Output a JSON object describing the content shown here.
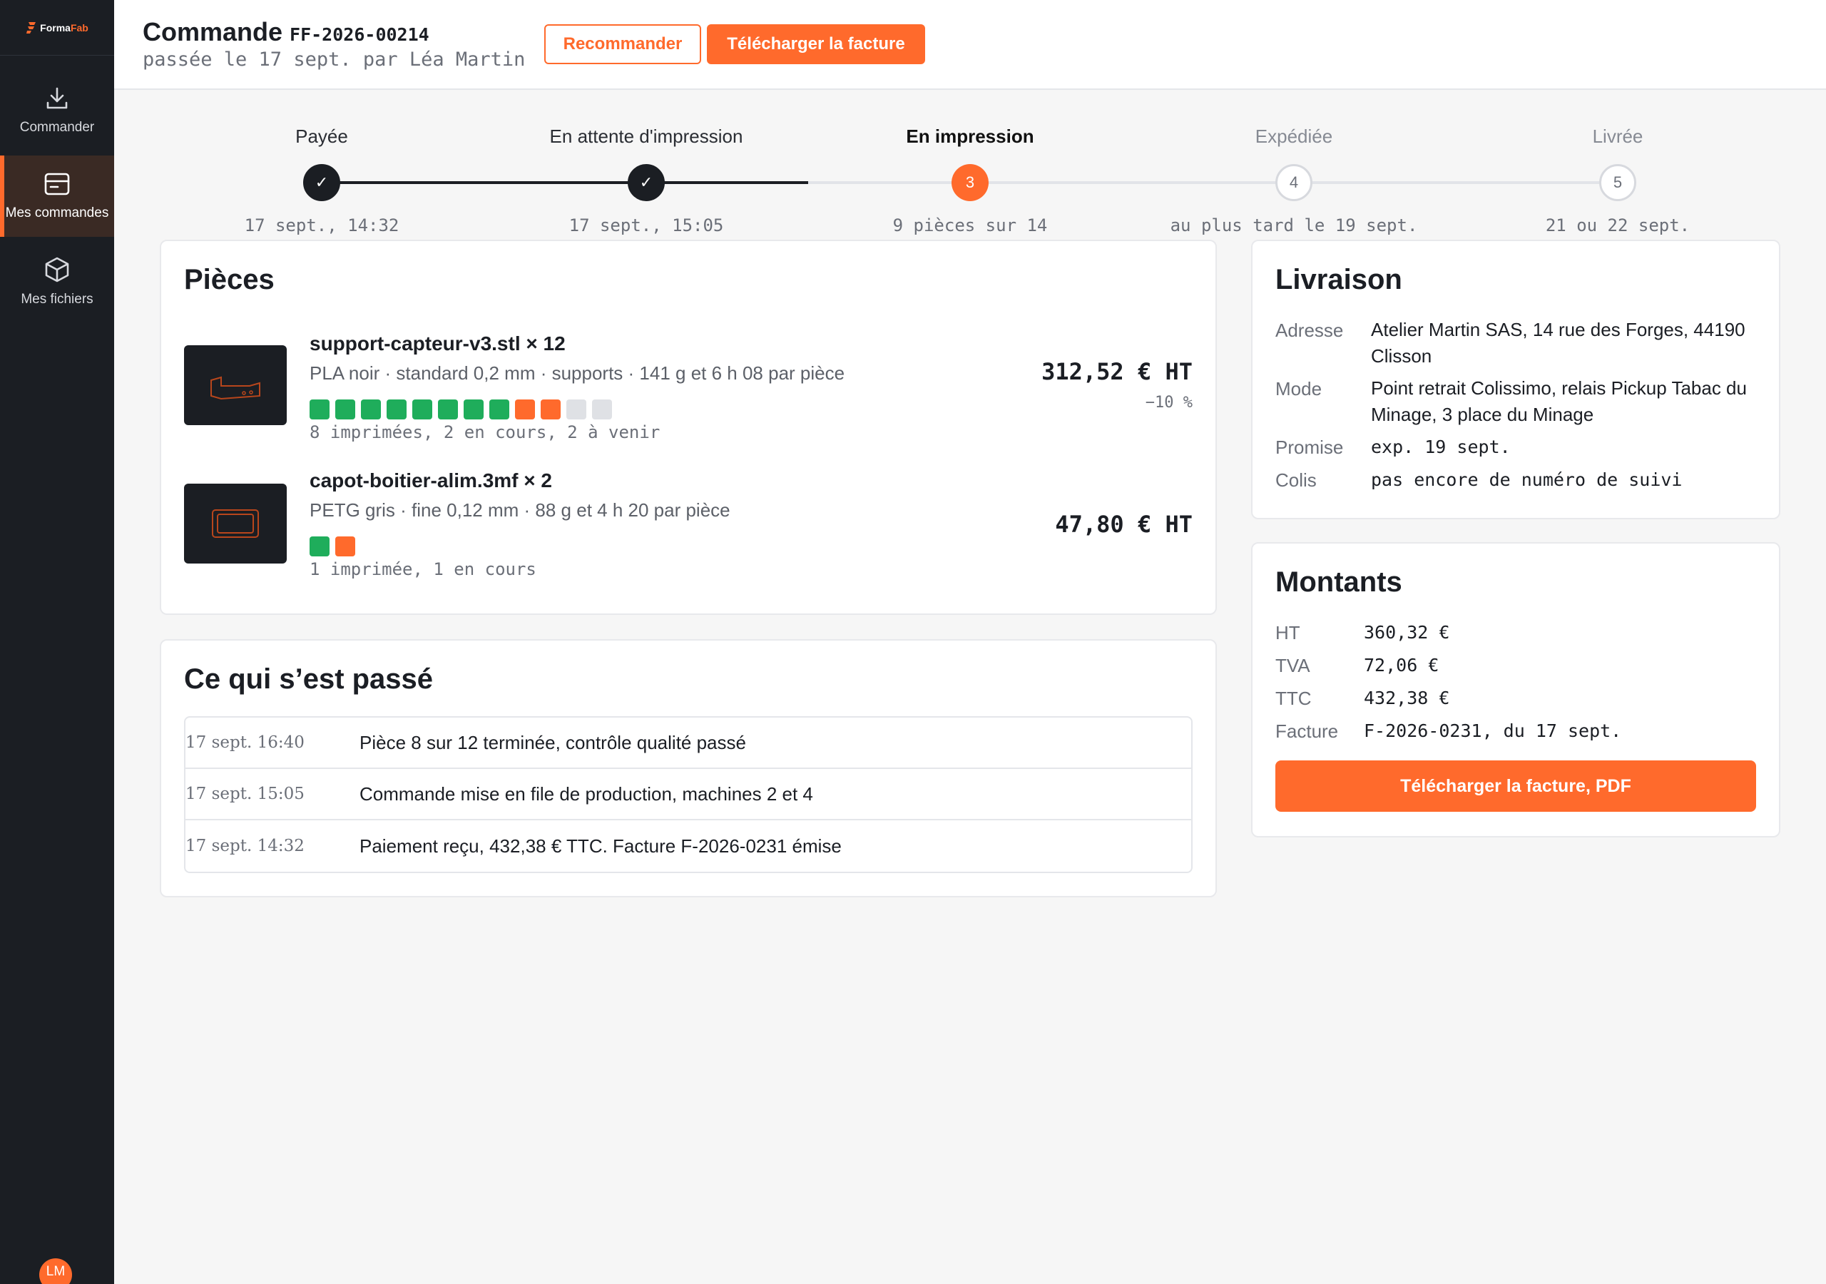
{
  "brand": {
    "name_part1": "Forma",
    "name_part2": "Fab"
  },
  "nav": [
    {
      "label": "Commander",
      "icon": "download-icon"
    },
    {
      "label": "Mes commandes",
      "icon": "orders-icon",
      "active": true
    },
    {
      "label": "Mes fichiers",
      "icon": "cube-icon"
    }
  ],
  "user": {
    "initials": "LM"
  },
  "order": {
    "title": "Commande",
    "id": "FF-2026-00214",
    "subtitle": "passée le 17 sept. par Léa Martin"
  },
  "actions": {
    "reorder": "Recommander",
    "download_invoice": "Télécharger la facture"
  },
  "steps": [
    {
      "label": "Payée",
      "date": "17 sept., 14:32",
      "state": "done",
      "marker": "✓"
    },
    {
      "label": "En attente d'impression",
      "date": "17 sept., 15:05",
      "state": "done",
      "marker": "✓"
    },
    {
      "label": "En impression",
      "date": "9 pièces sur 14",
      "state": "current",
      "marker": "3"
    },
    {
      "label": "Expédiée",
      "date": "au plus tard le 19 sept.",
      "state": "future",
      "marker": "4"
    },
    {
      "label": "Livrée",
      "date": "21 ou 22 sept.",
      "state": "future",
      "marker": "5"
    }
  ],
  "pieces": {
    "title": "Pièces",
    "items": [
      {
        "name": "support-capteur-v3.stl × 12",
        "spec": "PLA noir · standard 0,2 mm · supports · 141 g et 6 h 08 par pièce",
        "status": "8 imprimées, 2 en cours, 2 à venir",
        "counts": {
          "done": 8,
          "progress": 2,
          "todo": 2
        },
        "price": "312,52 € HT",
        "discount": "−10 %"
      },
      {
        "name": "capot-boitier-alim.3mf × 2",
        "spec": "PETG gris · fine 0,12 mm · 88 g et 4 h 20 par pièce",
        "status": "1 imprimée, 1 en cours",
        "counts": {
          "done": 1,
          "progress": 1,
          "todo": 0
        },
        "price": "47,80 € HT",
        "discount": ""
      }
    ]
  },
  "history": {
    "title": "Ce qui s’est passé",
    "events": [
      {
        "time": "17 sept. 16:40",
        "text": "Pièce 8 sur 12 terminée, contrôle qualité passé"
      },
      {
        "time": "17 sept. 15:05",
        "text": "Commande mise en file de production, machines 2 et 4"
      },
      {
        "time": "17 sept. 14:32",
        "text": "Paiement reçu, 432,38 € TTC. Facture F-2026-0231 émise"
      }
    ]
  },
  "delivery": {
    "title": "Livraison",
    "address_label": "Adresse",
    "address": "Atelier Martin SAS, 14 rue des Forges, 44190 Clisson",
    "mode_label": "Mode",
    "mode": "Point retrait Colissimo, relais Pickup Tabac du Minage, 3 place du Minage",
    "promised_label": "Promise",
    "promised": "exp. 19 sept.",
    "parcel_label": "Colis",
    "parcel": "pas encore de numéro de suivi"
  },
  "amounts": {
    "title": "Montants",
    "ht_label": "HT",
    "ht": "360,32 €",
    "tva_label": "TVA",
    "tva": "72,06 €",
    "ttc_label": "TTC",
    "ttc": "432,38 €",
    "invoice_label": "Facture",
    "invoice": "F-2026-0231, du 17 sept.",
    "download_pdf": "Télécharger la facture, PDF"
  },
  "colors": {
    "accent": "#ff6a2c",
    "done": "#1fad5b",
    "dark": "#1b1e23",
    "todo": "#dfe1e5"
  }
}
